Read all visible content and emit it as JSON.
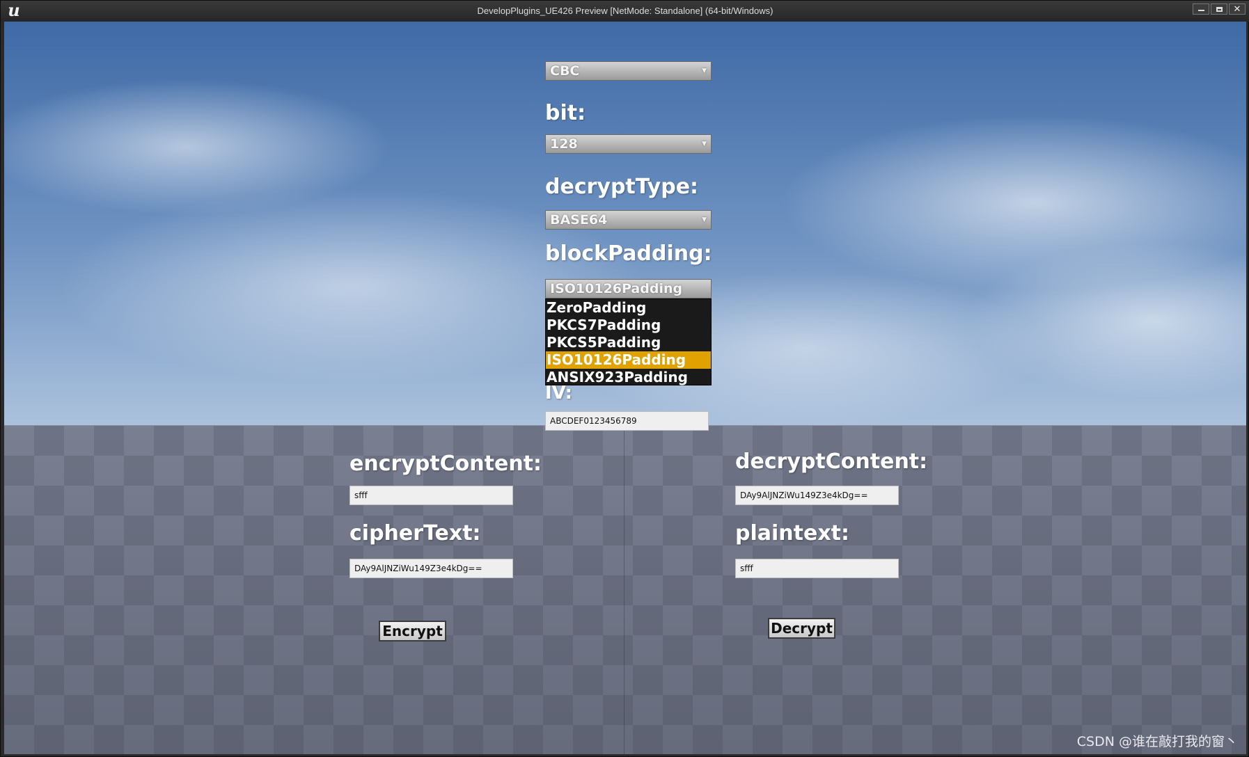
{
  "window": {
    "title": "DevelopPlugins_UE426 Preview [NetMode: Standalone]  (64-bit/Windows)",
    "logo_letter": "u",
    "close_glyph": "✕"
  },
  "form": {
    "mode_value": "CBC",
    "bit_label": "bit:",
    "bit_value": "128",
    "decrypt_type_label": "decryptType:",
    "decrypt_type_value": "BASE64",
    "block_padding_label": "blockPadding:",
    "block_padding_value": "ISO10126Padding",
    "padding_options": [
      "ZeroPadding",
      "PKCS7Padding",
      "PKCS5Padding",
      "ISO10126Padding",
      "ANSIX923Padding"
    ],
    "padding_selected_index": 3,
    "iv_label": "IV:",
    "iv_value": "ABCDEF0123456789",
    "encrypt_content_label": "encryptContent:",
    "encrypt_content_value": "sfff",
    "cipher_text_label": "cipherText:",
    "cipher_text_value": "DAy9AlJNZiWu149Z3e4kDg==",
    "decrypt_content_label": "decryptContent:",
    "decrypt_content_value": "DAy9AlJNZiWu149Z3e4kDg==",
    "plaintext_label": "plaintext:",
    "plaintext_value": "sfff",
    "encrypt_button": "Encrypt",
    "decrypt_button": "Decrypt"
  },
  "watermark": "CSDN @谁在敲打我的窗丶",
  "colors": {
    "selected_highlight": "#e0a200",
    "dropdown_bg": "#1a1a1a"
  }
}
